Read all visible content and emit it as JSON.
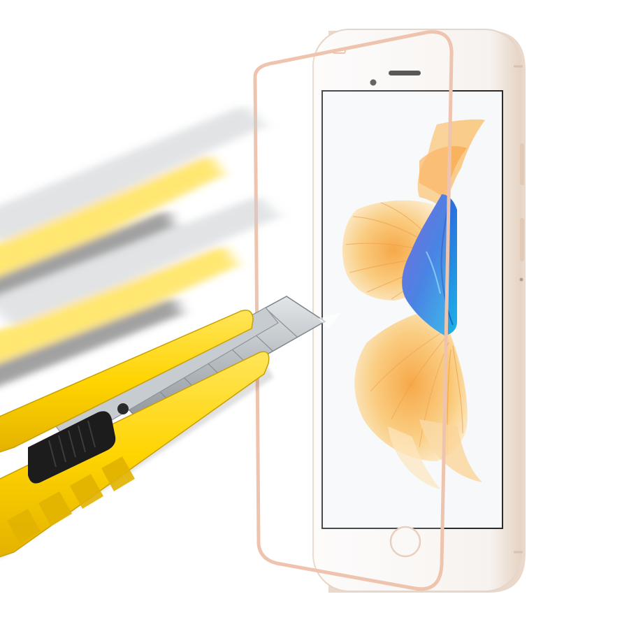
{
  "scene": {
    "background": "#ffffff",
    "colors": {
      "phone_body": "#fbf9f7",
      "phone_edge": "#e8d6c6",
      "rose_gold_frame": "#efc4ae",
      "screen_bg": "#f7f9fb",
      "fish_orange": "#f7a94a",
      "fish_cream": "#fde7c0",
      "fish_blue": "#2f6fd6",
      "cutter_yellow": "#ffd400",
      "cutter_yellow_dark": "#e0b200",
      "cutter_black": "#1c1c1c",
      "blade_steel": "#b9bec3"
    },
    "icons": {
      "phone": "smartphone-icon",
      "protector": "screen-protector-icon",
      "cutter": "utility-knife-icon"
    }
  }
}
